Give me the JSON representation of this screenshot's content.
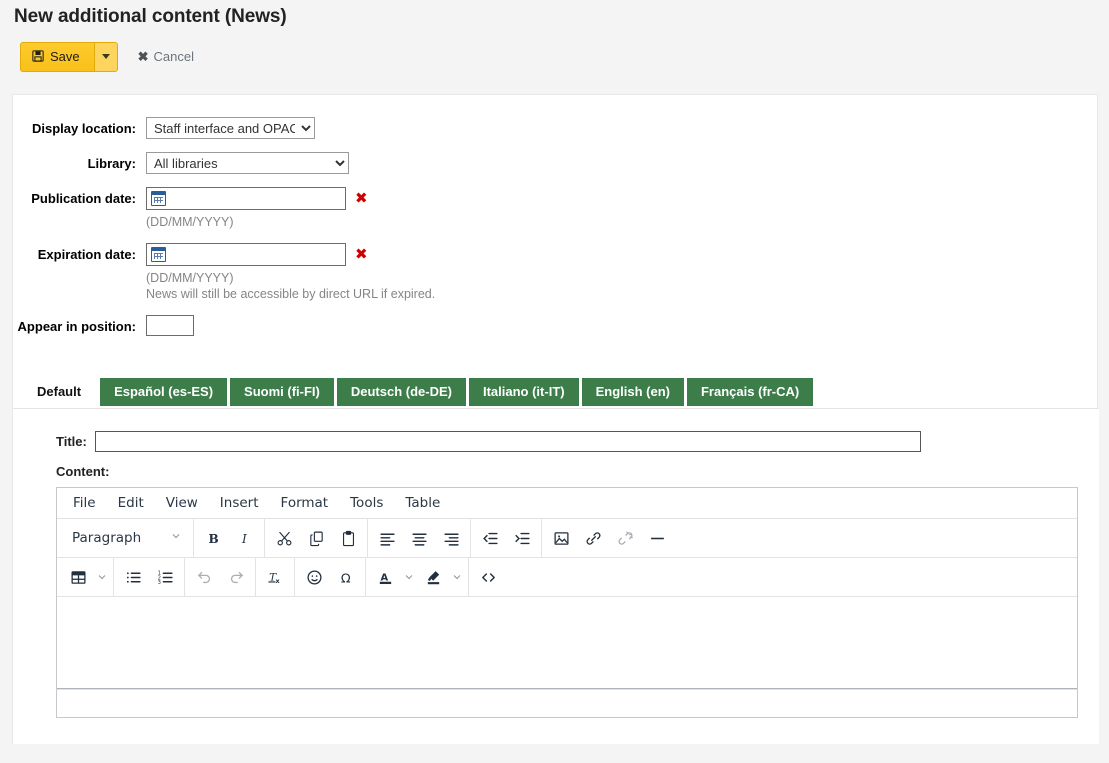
{
  "page": {
    "title": "New additional content (News)"
  },
  "toolbar": {
    "save_label": "Save",
    "save_icon": "floppy-disk-icon",
    "save_dropdown_icon": "caret-down-icon",
    "cancel_label": "Cancel",
    "cancel_icon": "times-icon",
    "save_bg_color": "#fcc30b",
    "save_caret_bg_color": "#fdd55e"
  },
  "form": {
    "display_location": {
      "label": "Display location:",
      "value": "Staff interface and OPAC"
    },
    "library": {
      "label": "Library:",
      "value": "All libraries"
    },
    "publication_date": {
      "label": "Publication date:",
      "value": "",
      "icon": "calendar-icon",
      "clear_icon": "red-x-icon",
      "hint": "(DD/MM/YYYY)"
    },
    "expiration_date": {
      "label": "Expiration date:",
      "value": "",
      "icon": "calendar-icon",
      "clear_icon": "red-x-icon",
      "hint": "(DD/MM/YYYY)",
      "hint2": "News will still be accessible by direct URL if expired."
    },
    "appear_in_position": {
      "label": "Appear in position:",
      "value": ""
    }
  },
  "tabs": {
    "active_color": "#ffffff",
    "inactive_bg_color": "#3c7d4a",
    "items": [
      {
        "label": "Default",
        "active": true
      },
      {
        "label": "Español (es-ES)",
        "active": false
      },
      {
        "label": "Suomi (fi-FI)",
        "active": false
      },
      {
        "label": "Deutsch (de-DE)",
        "active": false
      },
      {
        "label": "Italiano (it-IT)",
        "active": false
      },
      {
        "label": "English (en)",
        "active": false
      },
      {
        "label": "Français (fr-CA)",
        "active": false
      }
    ]
  },
  "panel": {
    "title_label": "Title:",
    "title_value": "",
    "content_label": "Content:"
  },
  "editor": {
    "menubar": [
      "File",
      "Edit",
      "View",
      "Insert",
      "Format",
      "Tools",
      "Table"
    ],
    "format_select": "Paragraph",
    "body_text": "",
    "toolbar_row1": [
      "bold-icon",
      "italic-icon",
      "cut-icon",
      "copy-icon",
      "paste-icon",
      "align-left-icon",
      "align-center-icon",
      "align-right-icon",
      "outdent-icon",
      "indent-icon",
      "insert-image-icon",
      "insert-link-icon",
      "unlink-icon",
      "horizontal-rule-icon"
    ],
    "toolbar_row2": [
      "insert-table-icon",
      "bullet-list-icon",
      "numbered-list-icon",
      "undo-icon",
      "redo-icon",
      "clear-formatting-icon",
      "emoticon-icon",
      "special-character-icon",
      "text-color-icon",
      "background-color-icon",
      "source-code-icon"
    ]
  }
}
